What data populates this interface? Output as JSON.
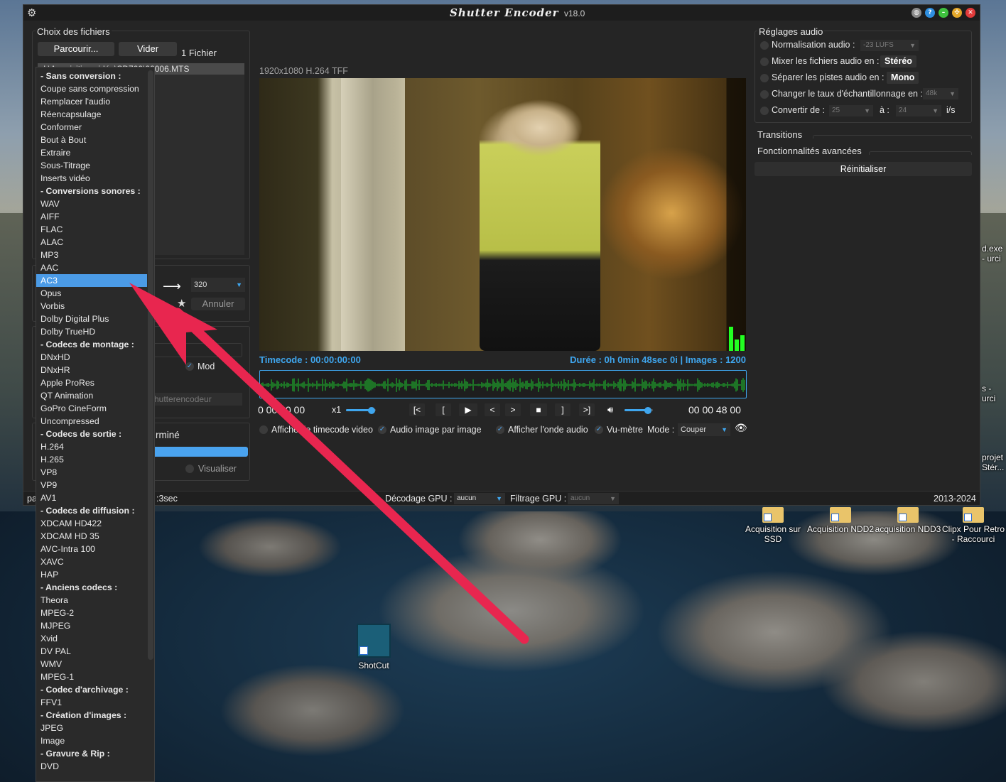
{
  "window": {
    "title": "Shutter Encoder",
    "version": "v18.0"
  },
  "files": {
    "section_title": "Choix des fichiers",
    "browse_label": "Parcourir...",
    "clear_label": "Vider",
    "count_label": "1 Fichier",
    "first_file": "I:\\Acquisition vidéo\\SD700\\00006.MTS"
  },
  "codec_dropdown": {
    "items": [
      {
        "label": "- Sans conversion :",
        "header": true
      },
      {
        "label": "Coupe sans compression"
      },
      {
        "label": "Remplacer l'audio"
      },
      {
        "label": "Réencapsulage"
      },
      {
        "label": "Conformer"
      },
      {
        "label": "Bout à Bout"
      },
      {
        "label": "Extraire"
      },
      {
        "label": "Sous-Titrage"
      },
      {
        "label": "Inserts vidéo"
      },
      {
        "label": "- Conversions sonores :",
        "header": true
      },
      {
        "label": "WAV"
      },
      {
        "label": "AIFF"
      },
      {
        "label": "FLAC"
      },
      {
        "label": "ALAC"
      },
      {
        "label": "MP3"
      },
      {
        "label": "AAC"
      },
      {
        "label": "AC3",
        "selected": true
      },
      {
        "label": "Opus"
      },
      {
        "label": "Vorbis"
      },
      {
        "label": "Dolby Digital Plus"
      },
      {
        "label": "Dolby TrueHD"
      },
      {
        "label": "- Codecs de montage :",
        "header": true
      },
      {
        "label": "DNxHD"
      },
      {
        "label": "DNxHR"
      },
      {
        "label": "Apple ProRes"
      },
      {
        "label": "QT Animation"
      },
      {
        "label": "GoPro CineForm"
      },
      {
        "label": "Uncompressed"
      },
      {
        "label": "- Codecs de sortie :",
        "header": true
      },
      {
        "label": "H.264"
      },
      {
        "label": "H.265"
      },
      {
        "label": "VP8"
      },
      {
        "label": "VP9"
      },
      {
        "label": "AV1"
      },
      {
        "label": "- Codecs de diffusion :",
        "header": true
      },
      {
        "label": "XDCAM HD422"
      },
      {
        "label": "XDCAM HD 35"
      },
      {
        "label": "AVC-Intra 100"
      },
      {
        "label": "XAVC"
      },
      {
        "label": "HAP"
      },
      {
        "label": "- Anciens codecs :",
        "header": true
      },
      {
        "label": "Theora"
      },
      {
        "label": "MPEG-2"
      },
      {
        "label": "MJPEG"
      },
      {
        "label": "Xvid"
      },
      {
        "label": "DV PAL"
      },
      {
        "label": "WMV"
      },
      {
        "label": "MPEG-1"
      },
      {
        "label": "- Codec d'archivage :",
        "header": true
      },
      {
        "label": "FFV1"
      },
      {
        "label": "- Création d'images :",
        "header": true
      },
      {
        "label": "JPEG"
      },
      {
        "label": "Image"
      },
      {
        "label": "- Gravure & Rip :",
        "header": true
      },
      {
        "label": "DVD"
      }
    ]
  },
  "output": {
    "bitrate_value": "320",
    "cancel_label": "Annuler",
    "modif_label": "Mod",
    "output_placeholder": "hutterencodeur",
    "status_label": "rminé",
    "view_label": "Visualiser",
    "progress_value": 1.0
  },
  "player": {
    "video_info": "1920x1080 H.264 TFF",
    "timecode_label": "Timecode : 00:00:00:00",
    "duration_label": "Durée : 0h 0min 48sec 0i | Images : 1200",
    "start_tc": "0  00 00 00",
    "speed_label": "x1",
    "end_tc": "00 00 48 00",
    "buttons": [
      "[<",
      "[",
      "▶",
      "<",
      ">",
      "■",
      "]",
      ">]"
    ],
    "show_tc_label": "Afficher le timecode video",
    "frame_audio_label": "Audio image par image",
    "show_wave_label": "Afficher l'onde audio",
    "vu_label": "Vu-mètre",
    "mode_label": "Mode :",
    "mode_value": "Couper"
  },
  "audio_settings": {
    "title": "Réglages audio",
    "normalize_label": "Normalisation audio :",
    "normalize_value": "-23 LUFS",
    "mix_label": "Mixer les fichiers audio en :",
    "mix_value": "Stéréo",
    "split_label": "Séparer les pistes audio en :",
    "split_value": "Mono",
    "samplerate_label": "Changer le taux d'échantillonnage en :",
    "samplerate_value": "48k",
    "convert_label": "Convertir de :",
    "convert_from": "25",
    "convert_to_label": "à :",
    "convert_to": "24",
    "fps_unit": "i/s"
  },
  "right_sections": {
    "transitions": "Transitions",
    "advanced": "Fonctionnalités avancées",
    "reset": "Réinitialiser"
  },
  "status_bar": {
    "left": "pa",
    "time": ":3sec",
    "gpu_decode_label": "Décodage GPU :",
    "gpu_decode_value": "aucun",
    "gpu_filter_label": "Filtrage GPU :",
    "gpu_filter_value": "aucun",
    "years": "2013-2024"
  },
  "desktop": {
    "icons": [
      {
        "label": "Acquisition sur SSD"
      },
      {
        "label": "Acquisition NDD2"
      },
      {
        "label": "acquisition NDD3"
      },
      {
        "label": "Clipx Pour Retro - Raccourci"
      },
      {
        "label": "ShotCut"
      }
    ],
    "edge_texts": [
      "d.exe - urci",
      "s - urci",
      "projet Stér..."
    ]
  },
  "colors": {
    "accent": "#3fa6ee",
    "selection": "#4b9be6",
    "arrow": "#e8264f",
    "panel_bg": "#252525"
  }
}
